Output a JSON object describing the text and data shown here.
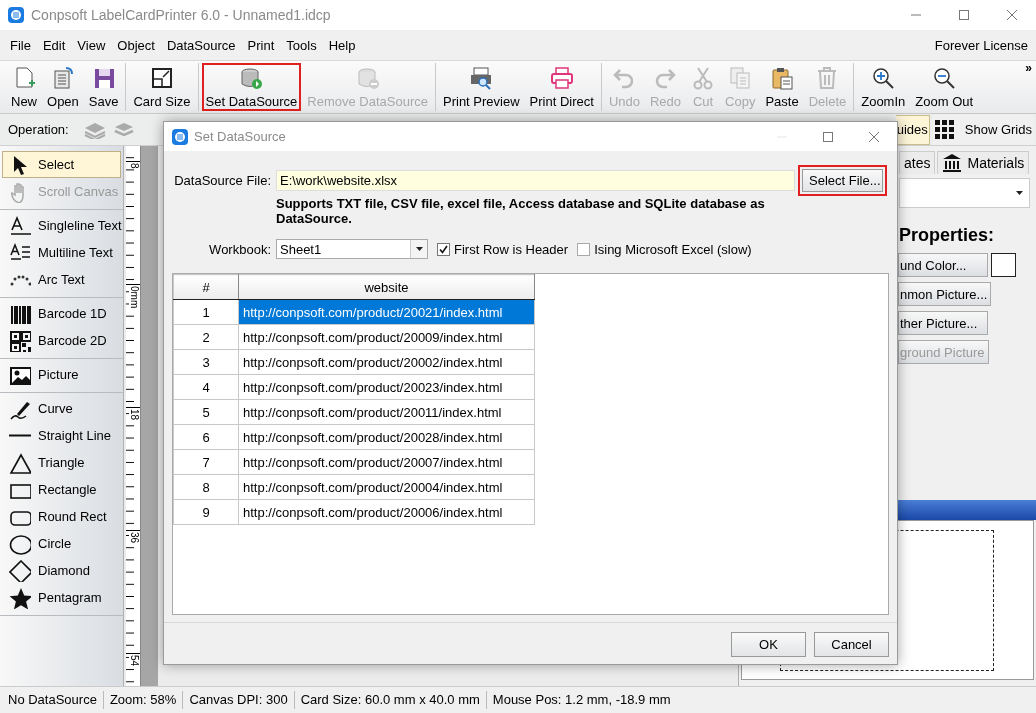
{
  "window": {
    "title": "Conpsoft LabelCardPrinter 6.0 - Unnamed1.idcp"
  },
  "menu": {
    "items": [
      "File",
      "Edit",
      "View",
      "Object",
      "DataSource",
      "Print",
      "Tools",
      "Help"
    ],
    "license": "Forever License"
  },
  "toolbar": {
    "groups": [
      [
        {
          "label": "New",
          "disabled": false,
          "highlighted": false
        },
        {
          "label": "Open",
          "disabled": false,
          "highlighted": false
        },
        {
          "label": "Save",
          "disabled": false,
          "highlighted": false
        }
      ],
      [
        {
          "label": "Card Size",
          "disabled": false,
          "highlighted": false
        }
      ],
      [
        {
          "label": "Set DataSource",
          "disabled": false,
          "highlighted": true
        },
        {
          "label": "Remove DataSource",
          "disabled": true,
          "highlighted": false
        }
      ],
      [
        {
          "label": "Print Preview",
          "disabled": false,
          "highlighted": false
        },
        {
          "label": "Print Direct",
          "disabled": false,
          "highlighted": false
        }
      ],
      [
        {
          "label": "Undo",
          "disabled": true,
          "highlighted": false
        },
        {
          "label": "Redo",
          "disabled": true,
          "highlighted": false
        },
        {
          "label": "Cut",
          "disabled": true,
          "highlighted": false
        },
        {
          "label": "Copy",
          "disabled": true,
          "highlighted": false
        },
        {
          "label": "Paste",
          "disabled": false,
          "highlighted": false
        },
        {
          "label": "Delete",
          "disabled": true,
          "highlighted": false
        }
      ],
      [
        {
          "label": "ZoomIn",
          "disabled": false,
          "highlighted": false
        },
        {
          "label": "Zoom Out",
          "disabled": false,
          "highlighted": false
        }
      ]
    ],
    "overflow": "»"
  },
  "operation_bar": {
    "label": "Operation:",
    "guides_button": "uides",
    "grids_button": "Show Grids"
  },
  "tool_panel": {
    "groups": [
      [
        {
          "label": "Select",
          "selected": true,
          "disabled": false
        },
        {
          "label": "Scroll Canvas",
          "selected": false,
          "disabled": true
        }
      ],
      [
        {
          "label": "Singleline Text",
          "selected": false,
          "disabled": false
        },
        {
          "label": "Multiline Text",
          "selected": false,
          "disabled": false
        },
        {
          "label": "Arc Text",
          "selected": false,
          "disabled": false
        }
      ],
      [
        {
          "label": "Barcode 1D",
          "selected": false,
          "disabled": false
        },
        {
          "label": "Barcode 2D",
          "selected": false,
          "disabled": false
        }
      ],
      [
        {
          "label": "Picture",
          "selected": false,
          "disabled": false
        }
      ],
      [
        {
          "label": "Curve",
          "selected": false,
          "disabled": false
        },
        {
          "label": "Straight Line",
          "selected": false,
          "disabled": false
        },
        {
          "label": "Triangle",
          "selected": false,
          "disabled": false
        },
        {
          "label": "Rectangle",
          "selected": false,
          "disabled": false
        },
        {
          "label": "Round Rect",
          "selected": false,
          "disabled": false
        },
        {
          "label": "Circle",
          "selected": false,
          "disabled": false
        },
        {
          "label": "Diamond",
          "selected": false,
          "disabled": false
        },
        {
          "label": "Pentagram",
          "selected": false,
          "disabled": false
        }
      ]
    ]
  },
  "ruler": {
    "labels": [
      "8",
      "0mm",
      "18",
      "36",
      "54"
    ]
  },
  "side_panel": {
    "tabs": [
      {
        "label": "ates",
        "selected": false
      },
      {
        "label": "Materials",
        "selected": false
      }
    ],
    "heading": "Properties:",
    "buttons": [
      {
        "label": "und Color...",
        "disabled": false
      },
      {
        "label": "nmon Picture...",
        "disabled": false
      },
      {
        "label": "ther Picture...",
        "disabled": false
      },
      {
        "label": "ground Picture",
        "disabled": true
      }
    ]
  },
  "dialog": {
    "title": "Set DataSource",
    "file_label": "DataSource File:",
    "file_value": "E:\\work\\website.xlsx",
    "select_button": {
      "label": "Select File...",
      "highlighted": true
    },
    "note": "Supports TXT file, CSV file, excel file, Access database and SQLite database as DataSource.",
    "workbook_label": "Workbook:",
    "workbook_value": "Sheet1",
    "options": [
      {
        "label": "First Row is Header",
        "checked": true
      },
      {
        "label": "Ising Microsoft Excel (slow)",
        "checked": false
      }
    ],
    "table": {
      "columns": [
        "#",
        "website"
      ],
      "rows": [
        {
          "cells": [
            "1",
            "http://conpsoft.com/product/20021/index.html"
          ],
          "selected": true
        },
        {
          "cells": [
            "2",
            "http://conpsoft.com/product/20009/index.html"
          ],
          "selected": false
        },
        {
          "cells": [
            "3",
            "http://conpsoft.com/product/20002/index.html"
          ],
          "selected": false
        },
        {
          "cells": [
            "4",
            "http://conpsoft.com/product/20023/index.html"
          ],
          "selected": false
        },
        {
          "cells": [
            "5",
            "http://conpsoft.com/product/20011/index.html"
          ],
          "selected": false
        },
        {
          "cells": [
            "6",
            "http://conpsoft.com/product/20028/index.html"
          ],
          "selected": false
        },
        {
          "cells": [
            "7",
            "http://conpsoft.com/product/20007/index.html"
          ],
          "selected": false
        },
        {
          "cells": [
            "8",
            "http://conpsoft.com/product/20004/index.html"
          ],
          "selected": false
        },
        {
          "cells": [
            "9",
            "http://conpsoft.com/product/20006/index.html"
          ],
          "selected": false
        }
      ]
    },
    "buttons": [
      "OK",
      "Cancel"
    ]
  },
  "status_bar": {
    "items": [
      "No DataSource",
      "Zoom: 58%",
      "Canvas DPI: 300",
      "Card Size: 60.0 mm x 40.0 mm",
      "Mouse Pos: 1.2 mm, -18.9 mm"
    ]
  }
}
